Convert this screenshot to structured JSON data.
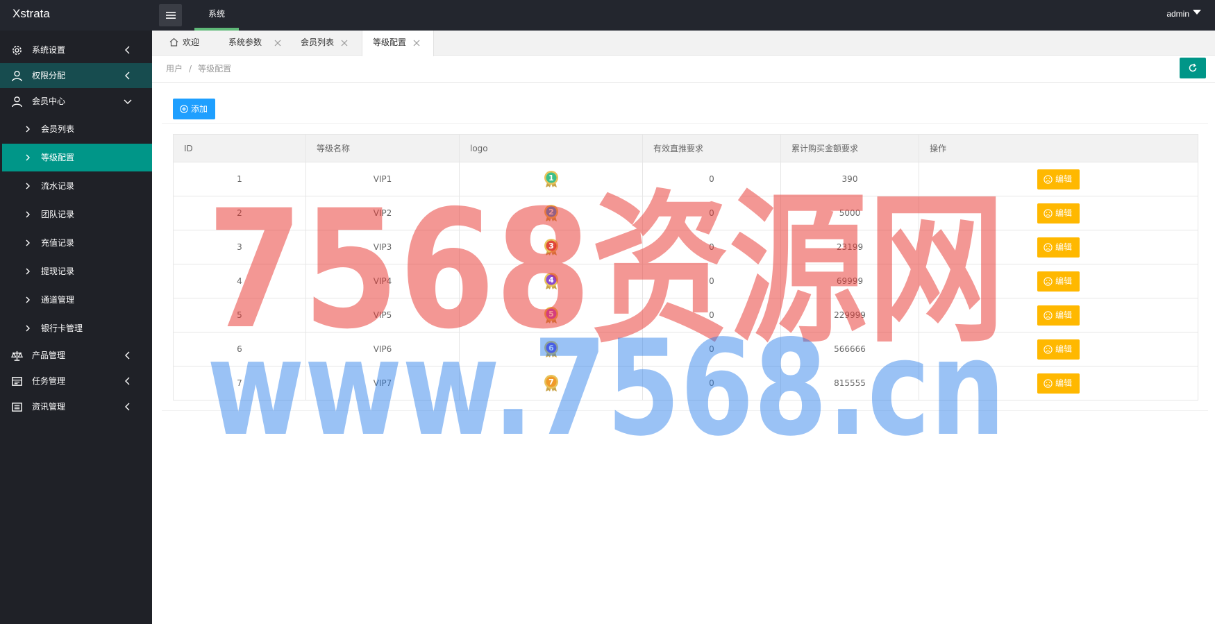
{
  "header": {
    "logo": "Xstrata",
    "nav_label": "系统",
    "user": "admin"
  },
  "sidebar": {
    "items": [
      {
        "label": "系统设置",
        "icon": "gear-icon"
      },
      {
        "label": "权限分配",
        "icon": "user-icon"
      },
      {
        "label": "会员中心",
        "icon": "user-icon"
      }
    ],
    "sub_items": [
      {
        "label": "会员列表"
      },
      {
        "label": "等级配置"
      },
      {
        "label": "流水记录"
      },
      {
        "label": "团队记录"
      },
      {
        "label": "充值记录"
      },
      {
        "label": "提现记录"
      },
      {
        "label": "通道管理"
      },
      {
        "label": "银行卡管理"
      }
    ],
    "items_after": [
      {
        "label": "产品管理",
        "icon": "scale-icon"
      },
      {
        "label": "任务管理",
        "icon": "task-icon"
      },
      {
        "label": "资讯管理",
        "icon": "news-icon"
      }
    ]
  },
  "tabs": [
    {
      "label": "欢迎"
    },
    {
      "label": "系统参数"
    },
    {
      "label": "会员列表"
    },
    {
      "label": "等级配置"
    }
  ],
  "breadcrumb": {
    "first": "用户",
    "separator": "/",
    "current": "等级配置"
  },
  "toolbar": {
    "add_label": "添加"
  },
  "table": {
    "columns": [
      "ID",
      "等级名称",
      "logo",
      "有效直推要求",
      "累计购买金额要求",
      "操作"
    ],
    "edit_label": "编辑",
    "rows": [
      {
        "id": "1",
        "name": "VIP1",
        "logo": "1",
        "direct": "0",
        "amount": "390",
        "medal_color": "#3cbf8a"
      },
      {
        "id": "2",
        "name": "VIP2",
        "logo": "2",
        "direct": "0",
        "amount": "5000",
        "medal_color": "#3c8fe0"
      },
      {
        "id": "3",
        "name": "VIP3",
        "logo": "3",
        "direct": "0",
        "amount": "23199",
        "medal_color": "#e04a3c"
      },
      {
        "id": "4",
        "name": "VIP4",
        "logo": "4",
        "direct": "0",
        "amount": "69999",
        "medal_color": "#8a4ad0"
      },
      {
        "id": "5",
        "name": "VIP5",
        "logo": "5",
        "direct": "0",
        "amount": "229999",
        "medal_color": "#c04ad0"
      },
      {
        "id": "6",
        "name": "VIP6",
        "logo": "6",
        "direct": "0",
        "amount": "566666",
        "medal_color": "#6a4ae0"
      },
      {
        "id": "7",
        "name": "VIP7",
        "logo": "7",
        "direct": "0",
        "amount": "815555",
        "medal_color": "#f09a2a"
      }
    ]
  },
  "watermark": {
    "line1": "7568资源网",
    "line2": "www.7568.cn"
  },
  "colors": {
    "sidebar_bg": "#1f2127",
    "active_teal": "#009688",
    "primary_blue": "#1e9fff",
    "edit_yellow": "#ffb800",
    "watermark_red": "#e8302a",
    "watermark_blue": "#1e78e8"
  }
}
